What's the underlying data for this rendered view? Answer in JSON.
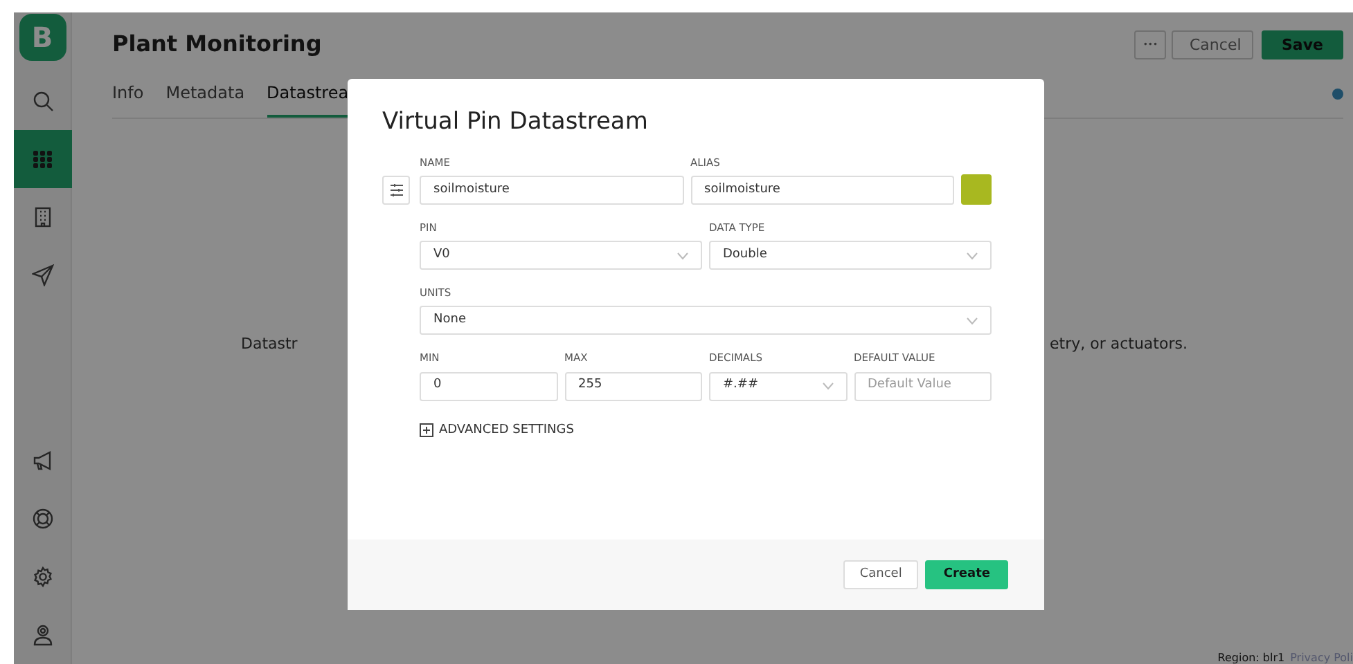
{
  "sidebar": {
    "items": [
      {
        "selected": false
      },
      {
        "selected": true
      },
      {
        "selected": false
      },
      {
        "selected": false
      }
    ],
    "bottom_items": [
      {
        "selected": false
      },
      {
        "selected": false
      },
      {
        "selected": false
      },
      {
        "selected": false
      }
    ],
    "logo": "B"
  },
  "header": {
    "title": "Plant Monitoring",
    "more": "•••",
    "buttons": [
      {
        "label": "Cancel",
        "kind": "secondary"
      },
      {
        "label": "Save",
        "kind": "primary"
      }
    ]
  },
  "tabs": [
    {
      "label": "Info",
      "selected": false
    },
    {
      "label": "Metadata",
      "selected": false
    },
    {
      "label": "Datastrea",
      "selected": true
    }
  ],
  "background_message": {
    "left_part": "Datastr",
    "right_part": "etry, or actuators."
  },
  "modal": {
    "title": "Virtual Pin Datastream",
    "rows": [
      {
        "fields": [
          {
            "kind": "text",
            "label": "NAME",
            "value": "soilmoisture"
          },
          {
            "kind": "text",
            "label": "ALIAS",
            "value": "soilmoisture"
          },
          {
            "kind": "color",
            "color": "#a8b820"
          }
        ]
      },
      {
        "fields": [
          {
            "kind": "select",
            "label": "PIN",
            "value": "V0"
          },
          {
            "kind": "select",
            "label": "DATA TYPE",
            "value": "Double"
          }
        ]
      },
      {
        "fields": [
          {
            "kind": "select",
            "label": "UNITS",
            "value": "None"
          }
        ]
      },
      {
        "fields": [
          {
            "kind": "text",
            "label": "MIN",
            "value": "0"
          },
          {
            "kind": "text",
            "label": "MAX",
            "value": "255"
          },
          {
            "kind": "select",
            "label": "DECIMALS",
            "value": "#.##"
          },
          {
            "kind": "text",
            "label": "DEFAULT VALUE",
            "placeholder": "Default Value"
          }
        ]
      }
    ],
    "advanced": {
      "label": "ADVANCED SETTINGS",
      "expanded": false
    },
    "buttons": [
      {
        "label": "Cancel",
        "kind": "secondary"
      },
      {
        "label": "Create",
        "kind": "primary"
      }
    ]
  },
  "footer": {
    "region": "Region: blr1",
    "link": "Privacy Poli"
  }
}
